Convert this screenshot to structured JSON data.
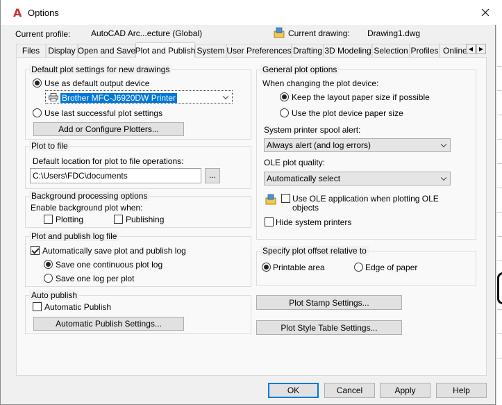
{
  "window": {
    "title": "Options"
  },
  "profile": {
    "label": "Current profile:",
    "value": "AutoCAD Arc...ecture (Global)",
    "drawing_label": "Current drawing:",
    "drawing_value": "Drawing1.dwg"
  },
  "tabs": [
    {
      "label": "Files"
    },
    {
      "label": "Display"
    },
    {
      "label": "Open and Save"
    },
    {
      "label": "Plot and Publish"
    },
    {
      "label": "System"
    },
    {
      "label": "User Preferences"
    },
    {
      "label": "Drafting"
    },
    {
      "label": "3D Modeling"
    },
    {
      "label": "Selection"
    },
    {
      "label": "Profiles"
    },
    {
      "label": "Online"
    }
  ],
  "default_plot": {
    "title": "Default plot settings for new drawings",
    "use_default_label": "Use as default output device",
    "device_value": "Brother MFC-J6920DW Printer",
    "use_last_label": "Use last successful plot settings",
    "add_plotters_label": "Add or Configure Plotters..."
  },
  "plot_to_file": {
    "title": "Plot to file",
    "location_label": "Default location for plot to file operations:",
    "location_value": "C:\\Users\\FDC\\documents",
    "browse_label": "..."
  },
  "background": {
    "title": "Background processing options",
    "enable_label": "Enable background plot when:",
    "plotting_label": "Plotting",
    "publishing_label": "Publishing"
  },
  "log_file": {
    "title": "Plot and publish log file",
    "auto_save_label": "Automatically save plot and publish log",
    "continuous_label": "Save one continuous plot log",
    "per_plot_label": "Save one log per plot"
  },
  "auto_publish": {
    "title": "Auto publish",
    "checkbox_label": "Automatic Publish",
    "settings_label": "Automatic Publish Settings..."
  },
  "general": {
    "title": "General plot options",
    "changing_label": "When changing the plot device:",
    "keep_layout_label": "Keep the layout paper size if possible",
    "use_device_label": "Use the plot device paper size",
    "spool_label": "System printer spool alert:",
    "spool_value": "Always alert (and log errors)",
    "ole_quality_label": "OLE plot quality:",
    "ole_quality_value": "Automatically select",
    "use_ole_label_1": "Use OLE application when plotting OLE",
    "use_ole_label_2": "objects",
    "hide_printers_label": "Hide system printers"
  },
  "offset": {
    "title": "Specify plot offset relative to",
    "printable_label": "Printable area",
    "edge_label": "Edge of paper"
  },
  "buttons": {
    "plot_stamp": "Plot Stamp Settings...",
    "plot_style": "Plot Style Table Settings...",
    "ok": "OK",
    "cancel": "Cancel",
    "apply": "Apply",
    "help": "Help"
  },
  "colors": {
    "accent": "#0078d7",
    "logo_red": "#d0312d"
  }
}
